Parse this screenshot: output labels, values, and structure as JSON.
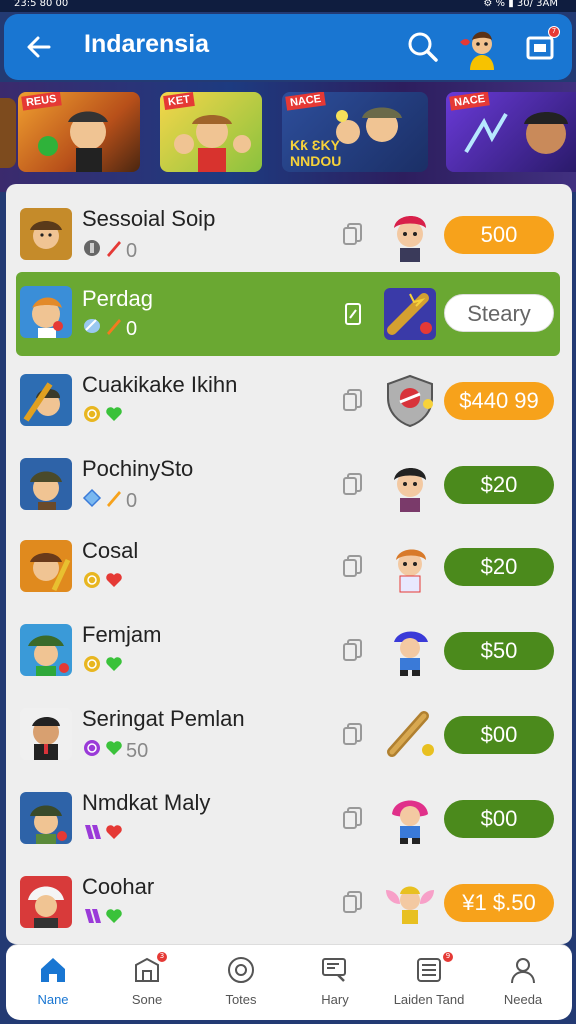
{
  "status_bar": {
    "time_left": "23:5 80 00",
    "right": "⚙ % ▮ 30/ 3AM"
  },
  "app_bar": {
    "title": "Indarensia",
    "notification_count": "7"
  },
  "banners": [
    {
      "tag": "REUS",
      "color": "#c46a1d"
    },
    {
      "tag": "KET",
      "color": "#e4c222"
    },
    {
      "tag": "NACE",
      "color": "#2d4e9b",
      "caption": "Kƙ ƐKY\nNNDOU"
    },
    {
      "tag": "NACE",
      "color": "#5b2ab8"
    }
  ],
  "rows": [
    {
      "name": "Sessoial Soip",
      "meta_count": "0",
      "meta_icons": [
        "gray-coin-icon",
        "red-rocket-icon"
      ],
      "price": "500",
      "price_style": "orange",
      "avatar": "red-hair-kid-avatar",
      "icon_color": "#c58b2a",
      "selected": false
    },
    {
      "name": "Perdag",
      "meta_count": "0",
      "meta_icons": [
        "blue-gem-icon",
        "orange-rocket-icon"
      ],
      "price": "Steary",
      "price_style": "white",
      "avatar": "telescope-item",
      "icon_color": "#3a8ed8",
      "selected": true
    },
    {
      "name": "Cuakikake Ikihn",
      "meta_count": "",
      "meta_icons": [
        "gold-coin-icon",
        "green-heart-icon"
      ],
      "price": "$440 99",
      "price_style": "orange",
      "avatar": "shield-item",
      "icon_color": "#2d6db3",
      "selected": false
    },
    {
      "name": "PochinySto",
      "meta_count": "0",
      "meta_icons": [
        "diamond-icon",
        "orange-rocket-icon"
      ],
      "price": "$20",
      "price_style": "green",
      "avatar": "dark-hair-kid-avatar",
      "icon_color": "#2e63a8",
      "selected": false
    },
    {
      "name": "Cosal",
      "meta_count": "",
      "meta_icons": [
        "gold-coin-icon",
        "red-heart-icon"
      ],
      "price": "$20",
      "price_style": "green",
      "avatar": "ginger-kid-avatar",
      "icon_color": "#e08a1e",
      "selected": false
    },
    {
      "name": "Femjam",
      "meta_count": "",
      "meta_icons": [
        "gold-coin-icon",
        "green-heart-icon"
      ],
      "price": "$50",
      "price_style": "green",
      "avatar": "cap-kid-avatar",
      "icon_color": "#3a9ad8",
      "selected": false
    },
    {
      "name": "Seringat Pemlan",
      "meta_count": "50",
      "meta_icons": [
        "purple-coin-icon",
        "green-heart-icon"
      ],
      "price": "$00",
      "price_style": "green",
      "avatar": "telescope-item",
      "icon_color": "#f0f0f0",
      "selected": false
    },
    {
      "name": "Nmdkat Maly",
      "meta_count": "",
      "meta_icons": [
        "purple-ribbon-icon",
        "red-heart-icon"
      ],
      "price": "$00",
      "price_style": "green",
      "avatar": "pink-hair-avatar",
      "icon_color": "#2e63a8",
      "selected": false
    },
    {
      "name": "Coohar",
      "meta_count": "",
      "meta_icons": [
        "purple-ribbon-icon",
        "green-heart-icon"
      ],
      "price": "¥1 $.50",
      "price_style": "orange",
      "avatar": "winged-fairy-avatar",
      "icon_color": "#d83a3a",
      "selected": false
    }
  ],
  "bottom_nav": [
    {
      "label": "Nane",
      "icon": "home-icon",
      "active": true,
      "badge": ""
    },
    {
      "label": "Sone",
      "icon": "store-icon",
      "active": false,
      "badge": "3"
    },
    {
      "label": "Totes",
      "icon": "disc-icon",
      "active": false,
      "badge": ""
    },
    {
      "label": "Hary",
      "icon": "search-list-icon",
      "active": false,
      "badge": ""
    },
    {
      "label": "Laiden Tand",
      "icon": "list-icon",
      "active": false,
      "badge": "9"
    },
    {
      "label": "Needa",
      "icon": "profile-icon",
      "active": false,
      "badge": ""
    }
  ],
  "colors": {
    "app_bar": "#1976d2",
    "selected_row": "#6aa832",
    "price_green": "#4b8a1c",
    "price_orange": "#f7a21b",
    "active_nav": "#1976d2"
  }
}
